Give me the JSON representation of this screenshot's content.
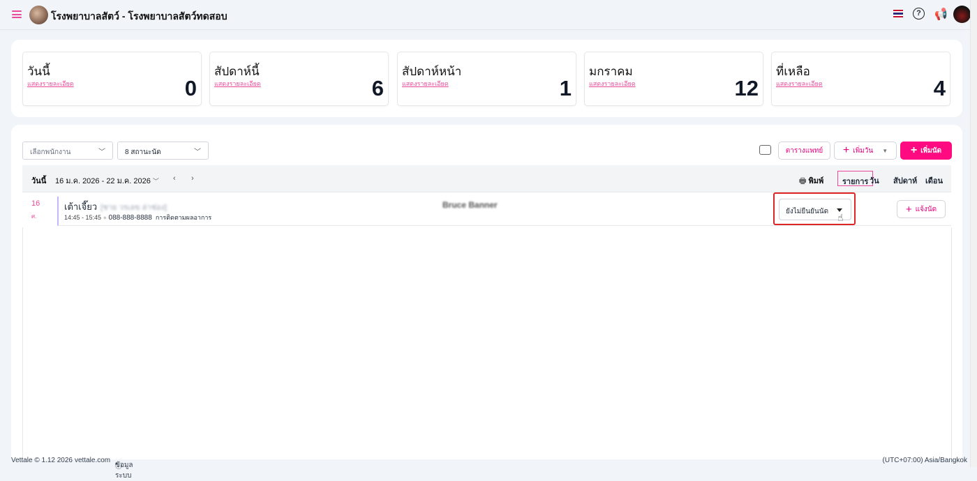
{
  "header": {
    "title": "โรงพยาบาลสัตว์ - โรงพยาบาลสัตว์ทดสอบ",
    "icons": [
      "menu-icon",
      "clinic-logo",
      "thai-flag-icon",
      "help-icon",
      "megaphone-icon",
      "avatar"
    ],
    "help_glyph": "?"
  },
  "stats": [
    {
      "label": "วันนี้",
      "link": "แสดงรายละเอียด",
      "value": "0"
    },
    {
      "label": "สัปดาห์นี้",
      "link": "แสดงรายละเอียด",
      "value": "6"
    },
    {
      "label": "สัปดาห์หน้า",
      "link": "แสดงรายละเอียด",
      "value": "1"
    },
    {
      "label": "มกราคม",
      "link": "แสดงรายละเอียด",
      "value": "12"
    },
    {
      "label": "ที่เหลือ",
      "link": "แสดงรายละเอียด",
      "value": "4"
    }
  ],
  "filters": {
    "staff_placeholder": "เลือกพนักงาน",
    "status": "8 สถานะนัด"
  },
  "actions": {
    "doctor_schedule": "ตารางแพทย์",
    "add_day": "เพิ่มวัน",
    "add_appointment": "เพิ่มนัด"
  },
  "toolbar": {
    "today": "วันนี้",
    "range": "16 ม.ค. 2026 - 22 ม.ค. 2026",
    "print": "พิมพ์",
    "views": [
      "รายการ",
      "วัน",
      "สัปดาห์",
      "เดือน"
    ],
    "active_view": "รายการ"
  },
  "appointments": [
    {
      "day": "16",
      "weekday": "ศ.",
      "pet": "เต้าเจี๊ยว",
      "owner": "[ชาย วรเลข ล่าช่อง]",
      "time": "14:45 - 15:45",
      "phone": "088-888-8888",
      "type": "การติดตามผลอาการ",
      "doctor": "Bruce Banner",
      "status": "ยังไม่ยืนยันนัด",
      "notify": "แจ้งนัด"
    }
  ],
  "footer": {
    "copyright": "Vettale © 1.12 2026",
    "site": "vettale.com",
    "sysinfo": "ข้อมูลระบบ",
    "timezone": "(UTC+07:00) Asia/Bangkok"
  },
  "colors": {
    "accent": "#ff0a80",
    "highlight": "#dc2626"
  }
}
